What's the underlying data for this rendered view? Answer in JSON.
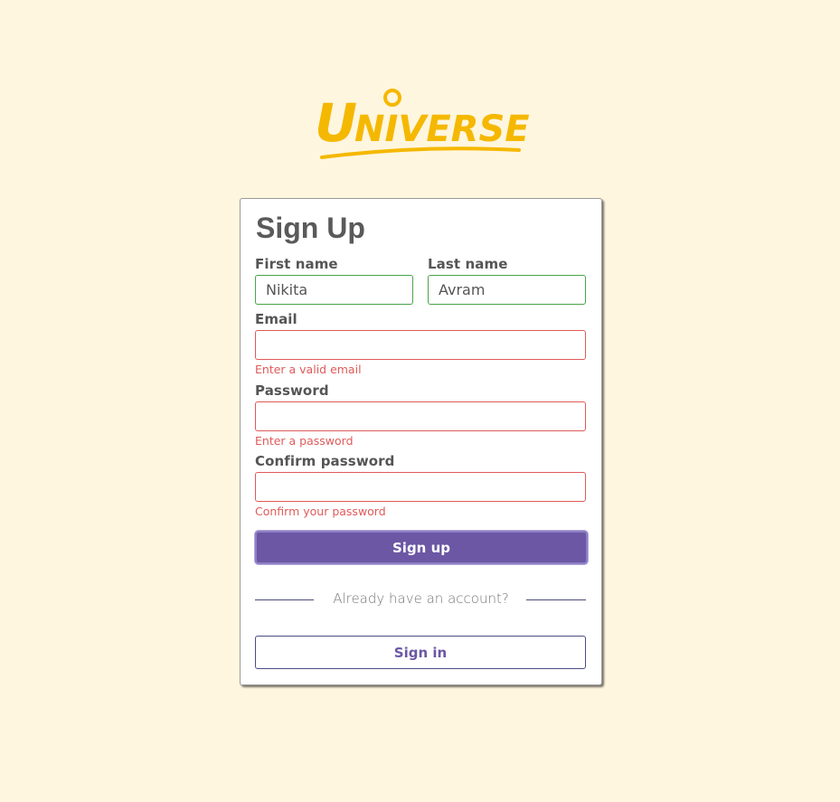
{
  "brand": {
    "logo_text": "Universe",
    "logo_color": "#f5b800"
  },
  "form": {
    "title": "Sign Up",
    "first_name": {
      "label": "First name",
      "value": "Nikita"
    },
    "last_name": {
      "label": "Last name",
      "value": "Avram"
    },
    "email": {
      "label": "Email",
      "value": "",
      "error": "Enter a valid email"
    },
    "password": {
      "label": "Password",
      "value": "",
      "error": "Enter a password"
    },
    "confirm_password": {
      "label": "Confirm password",
      "value": "",
      "error": "Confirm your password"
    },
    "submit_label": "Sign up",
    "divider_text": "Already have an account?",
    "signin_label": "Sign in"
  },
  "colors": {
    "background": "#fff6df",
    "accent": "#6b57a4",
    "error": "#e05a5a",
    "valid": "#49a349"
  }
}
